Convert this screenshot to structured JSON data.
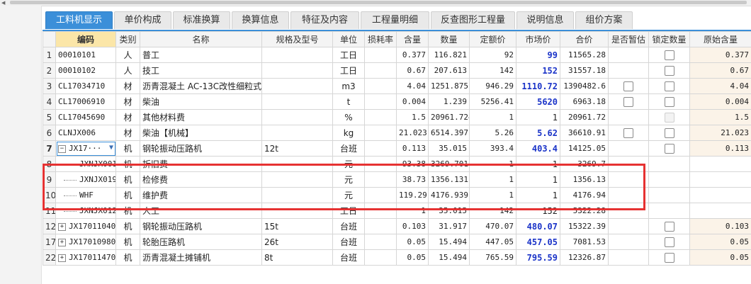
{
  "tabs": [
    "工料机显示",
    "单价构成",
    "标准换算",
    "换算信息",
    "特征及内容",
    "工程量明细",
    "反查图形工程量",
    "说明信息",
    "组价方案"
  ],
  "active_tab": "工料机显示",
  "columns": [
    "编码",
    "类别",
    "名称",
    "规格及型号",
    "单位",
    "损耗率",
    "含量",
    "数量",
    "定额价",
    "市场价",
    "合价",
    "是否暂估",
    "锁定数量",
    "原始含量"
  ],
  "rows": [
    {
      "rn": "1",
      "code": "00010101",
      "type": "人",
      "name": "普工",
      "spec": "",
      "unit": "工日",
      "loss": "",
      "content": "0.377",
      "qty": "116.821",
      "quota": "92",
      "market": "99",
      "total": "11565.28",
      "est": "",
      "lock": "cb",
      "orig": "0.377"
    },
    {
      "rn": "2",
      "code": "00010102",
      "type": "人",
      "name": "技工",
      "spec": "",
      "unit": "工日",
      "loss": "",
      "content": "0.67",
      "qty": "207.613",
      "quota": "142",
      "market": "152",
      "total": "31557.18",
      "est": "",
      "lock": "cb",
      "orig": "0.67"
    },
    {
      "rn": "3",
      "code": "CL17034710",
      "type": "材",
      "name": "沥青混凝土 AC-13C改性细粒式",
      "spec": "",
      "unit": "m3",
      "loss": "",
      "content": "4.04",
      "qty": "1251.875",
      "quota": "946.29",
      "market": "1110.72",
      "total": "1390482.6",
      "est": "cb",
      "lock": "cb",
      "orig": "4.04"
    },
    {
      "rn": "4",
      "code": "CL17006910",
      "type": "材",
      "name": "柴油",
      "spec": "",
      "unit": "t",
      "loss": "",
      "content": "0.004",
      "qty": "1.239",
      "quota": "5256.41",
      "market": "5620",
      "total": "6963.18",
      "est": "cb",
      "lock": "cb",
      "orig": "0.004"
    },
    {
      "rn": "5",
      "code": "CL17045690",
      "type": "材",
      "name": "其他材料费",
      "spec": "",
      "unit": "%",
      "loss": "",
      "content": "1.5",
      "qty": "20961.724",
      "quota": "1",
      "market": "1",
      "total": "20961.72",
      "est": "",
      "lock": "dis",
      "orig": "1.5"
    },
    {
      "rn": "6",
      "code": "CLNJX006",
      "type": "材",
      "name": "柴油【机械】",
      "spec": "",
      "unit": "kg",
      "loss": "",
      "content": "21.023",
      "qty": "6514.397",
      "quota": "5.26",
      "market": "5.62",
      "total": "36610.91",
      "est": "cb",
      "lock": "cb",
      "orig": "21.023"
    },
    {
      "rn": "7",
      "code": "JX17···",
      "type": "机",
      "name": "钢轮振动压路机",
      "spec": "12t",
      "unit": "台班",
      "loss": "",
      "content": "0.113",
      "qty": "35.015",
      "quota": "393.4",
      "market": "403.4",
      "total": "14125.05",
      "est": "",
      "lock": "cb",
      "orig": "0.113"
    },
    {
      "rn": "8",
      "code": "JXNJX001",
      "type": "机",
      "name": "折旧费",
      "spec": "",
      "unit": "元",
      "loss": "",
      "content": "93.38",
      "qty": "3269.701",
      "quota": "1",
      "market": "1",
      "total": "3269.7",
      "est": "",
      "lock": "",
      "orig": ""
    },
    {
      "rn": "9",
      "code": "JXNJX019",
      "type": "机",
      "name": "检修费",
      "spec": "",
      "unit": "元",
      "loss": "",
      "content": "38.73",
      "qty": "1356.131",
      "quota": "1",
      "market": "1",
      "total": "1356.13",
      "est": "",
      "lock": "",
      "orig": ""
    },
    {
      "rn": "10",
      "code": "WHF",
      "type": "机",
      "name": "维护费",
      "spec": "",
      "unit": "元",
      "loss": "",
      "content": "119.29",
      "qty": "4176.939",
      "quota": "1",
      "market": "1",
      "total": "4176.94",
      "est": "",
      "lock": "",
      "orig": ""
    },
    {
      "rn": "11",
      "code": "JXNJX012",
      "type": "机",
      "name": "人工",
      "spec": "",
      "unit": "工日",
      "loss": "",
      "content": "1",
      "qty": "35.015",
      "quota": "142",
      "market": "152",
      "total": "5322.28",
      "est": "",
      "lock": "",
      "orig": ""
    },
    {
      "rn": "12",
      "code": "JX17011040",
      "type": "机",
      "name": "钢轮振动压路机",
      "spec": "15t",
      "unit": "台班",
      "loss": "",
      "content": "0.103",
      "qty": "31.917",
      "quota": "470.07",
      "market": "480.07",
      "total": "15322.39",
      "est": "",
      "lock": "cb",
      "orig": "0.103"
    },
    {
      "rn": "17",
      "code": "JX17010980",
      "type": "机",
      "name": "轮胎压路机",
      "spec": "26t",
      "unit": "台班",
      "loss": "",
      "content": "0.05",
      "qty": "15.494",
      "quota": "447.05",
      "market": "457.05",
      "total": "7081.53",
      "est": "",
      "lock": "cb",
      "orig": "0.05"
    },
    {
      "rn": "22",
      "code": "JX17011470",
      "type": "机",
      "name": "沥青混凝土摊铺机",
      "spec": "8t",
      "unit": "台班",
      "loss": "",
      "content": "0.05",
      "qty": "15.494",
      "quota": "765.59",
      "market": "795.59",
      "total": "12326.87",
      "est": "",
      "lock": "cb",
      "orig": "0.05"
    }
  ],
  "colors": {
    "accent": "#3b8fd9",
    "market_blue": "#1a33c8",
    "highlight_box": "#e63232",
    "orig_bg": "#fbf3e8"
  }
}
